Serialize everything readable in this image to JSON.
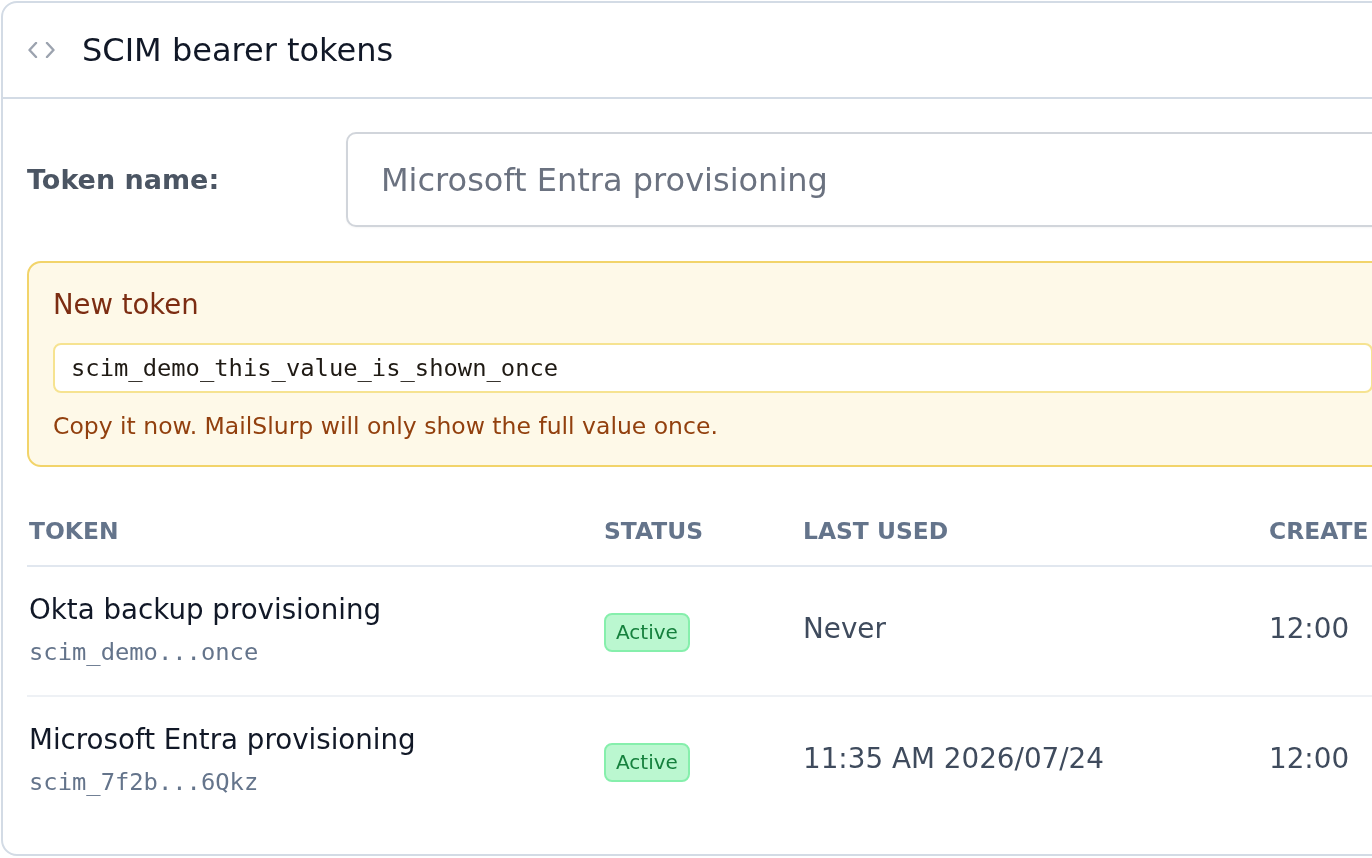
{
  "header": {
    "title": "SCIM bearer tokens"
  },
  "token_name": {
    "label": "Token name:",
    "placeholder": "Microsoft Entra provisioning"
  },
  "new_token": {
    "title": "New token",
    "value": "scim_demo_this_value_is_shown_once",
    "note": "Copy it now. MailSlurp will only show the full value once."
  },
  "table": {
    "columns": [
      "TOKEN",
      "STATUS",
      "LAST USED",
      "CREATE"
    ],
    "rows": [
      {
        "name": "Okta backup provisioning",
        "token": "scim_demo...once",
        "status": {
          "label": "Active",
          "kind": "active"
        },
        "last_used": "Never",
        "created": "12:00"
      },
      {
        "name": "Microsoft Entra provisioning",
        "token": "scim_7f2b...6Qkz",
        "status": {
          "label": "Active",
          "kind": "active"
        },
        "last_used": "11:35 AM 2026/07/24",
        "created": "12:00"
      }
    ]
  }
}
